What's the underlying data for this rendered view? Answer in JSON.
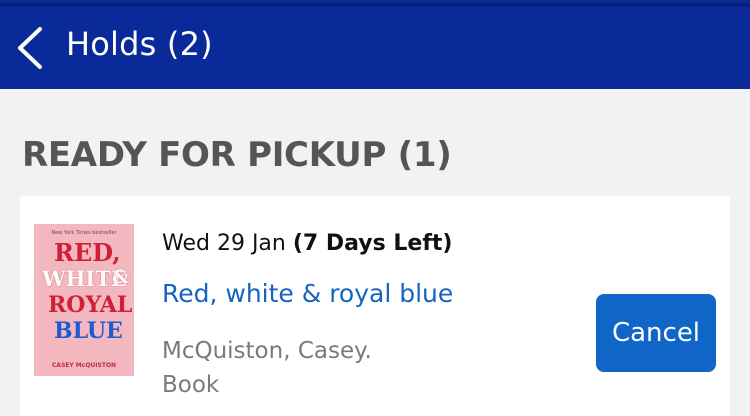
{
  "header": {
    "back_icon": "chevron-left-icon",
    "title": "Holds (2)"
  },
  "section": {
    "title": "READY FOR PICKUP (1)"
  },
  "hold": {
    "date": "Wed 29 Jan",
    "days_left": "(7 Days Left)",
    "title": "Red, white & royal blue",
    "author": "McQuiston, Casey.",
    "format": "Book",
    "cancel_label": "Cancel",
    "cover": {
      "top_text": "New York Times bestseller",
      "line1": "RED,",
      "line2": "WHITE",
      "amp": "&",
      "line3": "ROYAL",
      "line4": "BLUE",
      "author": "CASEY McQUISTON"
    }
  },
  "colors": {
    "header_bg": "#0a2a9a",
    "link": "#1565c0",
    "button": "#0f66c8"
  }
}
